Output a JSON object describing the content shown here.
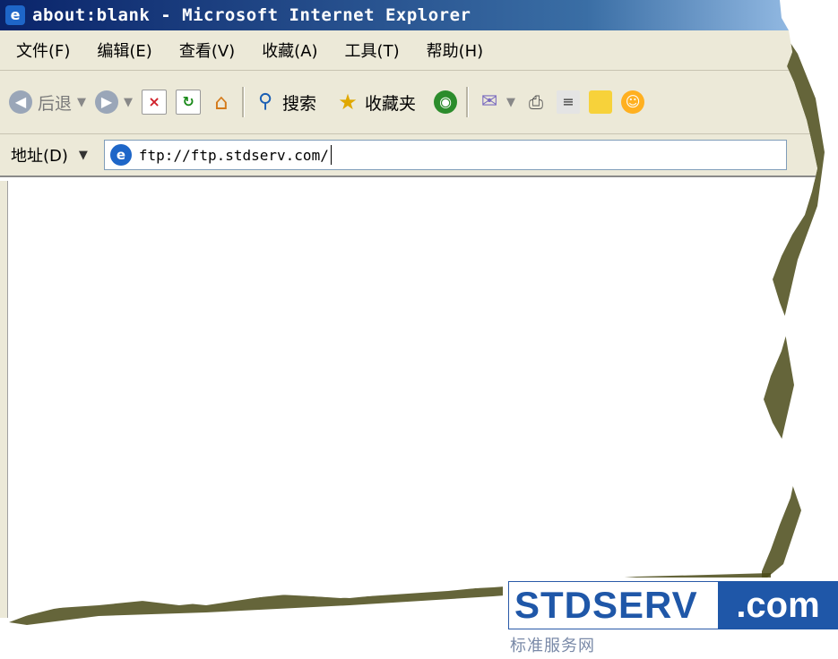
{
  "window": {
    "title": "about:blank - Microsoft Internet Explorer",
    "title_icon": "ie-icon"
  },
  "menu": {
    "items": [
      "文件(F)",
      "编辑(E)",
      "查看(V)",
      "收藏(A)",
      "工具(T)",
      "帮助(H)"
    ]
  },
  "toolbar": {
    "back_label": "后退",
    "search_label": "搜索",
    "favorites_label": "收藏夹"
  },
  "address": {
    "label": "地址(D)",
    "url": "ftp://ftp.stdserv.com/"
  },
  "watermark": {
    "brand_left": "STDSERV",
    "brand_right": ".com",
    "subtitle": "标准服务网"
  },
  "colors": {
    "titlebar": "#0a246a",
    "chrome": "#ece9d8",
    "brand_blue": "#1f57a8"
  }
}
